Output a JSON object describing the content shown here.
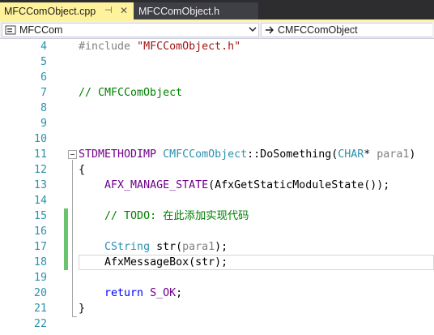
{
  "tabs": [
    {
      "label": "MFCComObject.cpp",
      "active": true,
      "pin_glyph": "⊣",
      "close_glyph": "✕"
    },
    {
      "label": "MFCComObject.h",
      "active": false
    }
  ],
  "navbar": {
    "scope_combo": {
      "value": "MFCCom",
      "icon": "class-icon"
    },
    "member_combo": {
      "value": "CMFCComObject",
      "icon": "arrow-right-icon"
    }
  },
  "editor": {
    "language": "C++",
    "lines": [
      {
        "number": "4",
        "text": "#include \"MFCComObject.h\""
      },
      {
        "number": "5",
        "text": ""
      },
      {
        "number": "6",
        "text": ""
      },
      {
        "number": "7",
        "text": "// CMFCComObject"
      },
      {
        "number": "8",
        "text": ""
      },
      {
        "number": "9",
        "text": ""
      },
      {
        "number": "10",
        "text": ""
      },
      {
        "number": "11",
        "text": "STDMETHODIMP CMFCComObject::DoSomething(CHAR* para1)"
      },
      {
        "number": "12",
        "text": "{"
      },
      {
        "number": "13",
        "text": "    AFX_MANAGE_STATE(AfxGetStaticModuleState());"
      },
      {
        "number": "14",
        "text": ""
      },
      {
        "number": "15",
        "text": "    // TODO: 在此添加实现代码"
      },
      {
        "number": "16",
        "text": ""
      },
      {
        "number": "17",
        "text": "    CString str(para1);"
      },
      {
        "number": "18",
        "text": "    AfxMessageBox(str);"
      },
      {
        "number": "19",
        "text": ""
      },
      {
        "number": "20",
        "text": "    return S_OK;"
      },
      {
        "number": "21",
        "text": "}"
      },
      {
        "number": "22",
        "text": ""
      }
    ],
    "tokens": {
      "l4_include": "#include",
      "l4_header": "\"MFCComObject.h\"",
      "l7_comment": "// CMFCComObject",
      "l11_macro": "STDMETHODIMP",
      "l11_class": "CMFCComObject",
      "l11_sep": "::DoSomething(",
      "l11_type": "CHAR",
      "l11_star": "* ",
      "l11_param": "para1",
      "l11_close": ")",
      "l12_brace": "{",
      "l13_macro": "AFX_MANAGE_STATE",
      "l13_rest": "(AfxGetStaticModuleState());",
      "l15_comment": "// TODO: 在此添加实现代码",
      "l17_type": "CString",
      "l17_mid": " str(",
      "l17_param": "para1",
      "l17_end": ");",
      "l18_call": "AfxMessageBox(str);",
      "l20_kw": "return",
      "l20_macro": "S_OK",
      "l20_end": ";",
      "l21_brace": "}"
    },
    "changed_lines": [
      "15",
      "16",
      "17",
      "18"
    ],
    "current_line": "18"
  },
  "colors": {
    "tab_active_bg": "#fff29d",
    "tab_strip_bg": "#2d2d30",
    "line_number": "#2b91af",
    "comment": "#008000",
    "string": "#a31515",
    "macro": "#6f008a",
    "keyword": "#0000ff",
    "type": "#2b91af",
    "preprocessor": "#808080",
    "change_marker": "#6bc46d"
  }
}
